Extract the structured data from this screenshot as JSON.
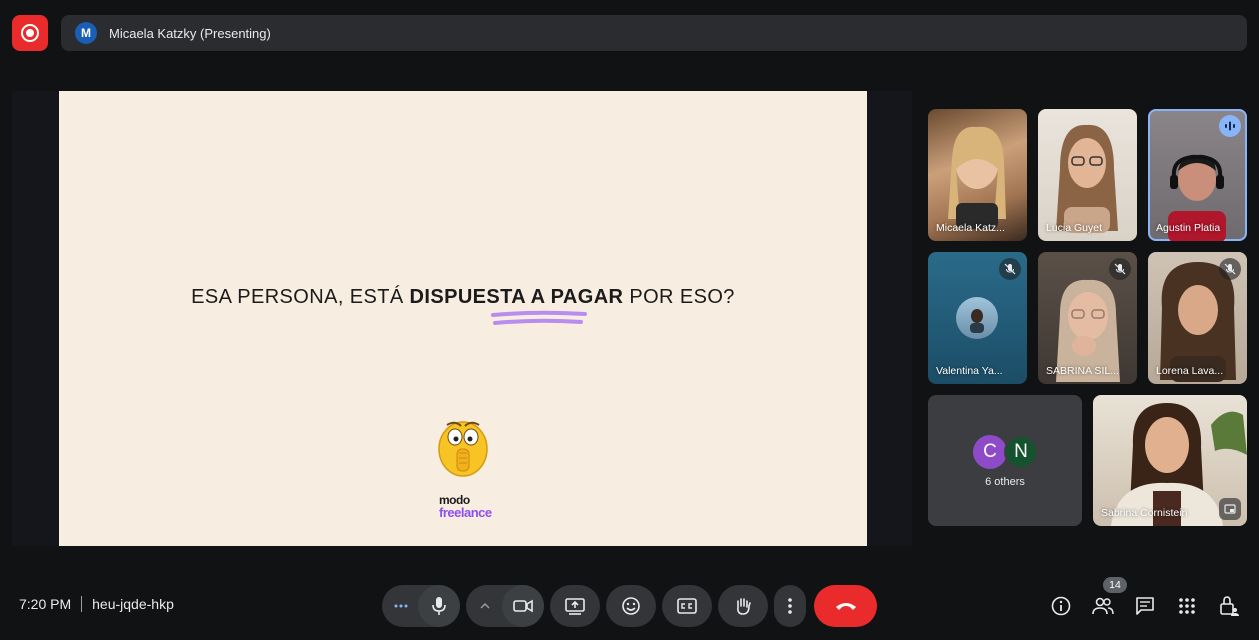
{
  "presenter": {
    "initial": "M",
    "label": "Micaela Katzky (Presenting)"
  },
  "slide": {
    "text_before": "ESA PERSONA, ESTÁ ",
    "text_bold": "DISPUESTA A PAGAR",
    "text_after": " POR ESO?",
    "logo_top": "modo",
    "logo_bottom": "freelance"
  },
  "participants": [
    {
      "name": "Micaela Katz..."
    },
    {
      "name": "Lucia Guyet"
    },
    {
      "name": "Agustin Platia"
    },
    {
      "name": "Valentina Ya..."
    },
    {
      "name": "SABRINA SIL..."
    },
    {
      "name": "Lorena Lava..."
    },
    {
      "name": "Sabrina Cornistein"
    }
  ],
  "others": {
    "avatar_1": "C",
    "avatar_2": "N",
    "label": "6 others"
  },
  "meeting": {
    "time": "7:20 PM",
    "code": "heu-jqde-hkp"
  },
  "people_count": "14",
  "colors": {
    "accent": "#8ab4f8",
    "end_call": "#ea2b2b",
    "slide_bg": "#f7ede1",
    "brand_purple": "#8f4ff0"
  }
}
